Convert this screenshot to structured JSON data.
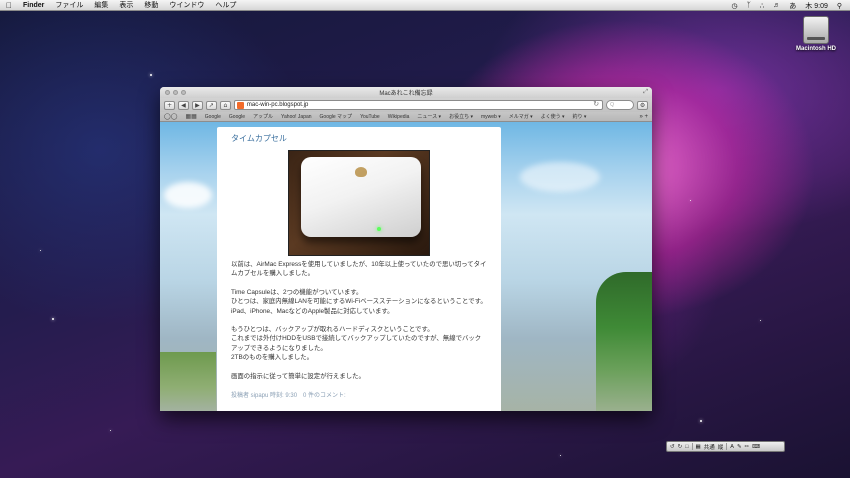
{
  "menubar": {
    "app_name": "Finder",
    "items": [
      "ファイル",
      "編集",
      "表示",
      "移動",
      "ウインドウ",
      "ヘルプ"
    ],
    "clock": "木 9:09",
    "input_method": "あ"
  },
  "desktop": {
    "drive_label": "Macintosh HD"
  },
  "browser": {
    "window_title": "Macあれこれ備忘録",
    "url": "mac-win-pc.blogspot.jp",
    "bookmarks": [
      "Google",
      "Google",
      "アップル",
      "Yahoo! Japan",
      "Google マップ",
      "YouTube",
      "Wikipedia",
      "ニュース ▾",
      "お役立ち ▾",
      "myweb ▾",
      "メルマガ ▾",
      "よく使う ▾",
      "釣り ▾"
    ]
  },
  "post": {
    "title": "タイムカプセル",
    "paragraph1": "以前は、AirMac Expressを使用していましたが、10年以上使っていたので思い切ってタイムカプセルを購入しました。",
    "paragraph2_line1": "Time Capsuleは、2つの機能がついています。",
    "paragraph2_line2": "ひとつは、家庭内無線LANを可能にするWi-Fiベースステーションになるということです。",
    "paragraph2_line3": "iPad、iPhone、MacなどのApple製品に対応しています。",
    "paragraph3_line1": "もうひとつは、バックアップが取れるハードディスクということです。",
    "paragraph3_line2": "これまでは外付けHDDをUSBで接続してバックアップしていたのですが、無線でバックアップできるようになりました。",
    "paragraph3_line3": "2TBのものを購入しました。",
    "paragraph4": "画面の指示に従って簡単に設定が行えました。",
    "footer": "投稿者 sipapu 時刻: 9:30　0 件のコメント:"
  },
  "palette": {
    "labels": [
      "共通",
      "縦"
    ]
  }
}
